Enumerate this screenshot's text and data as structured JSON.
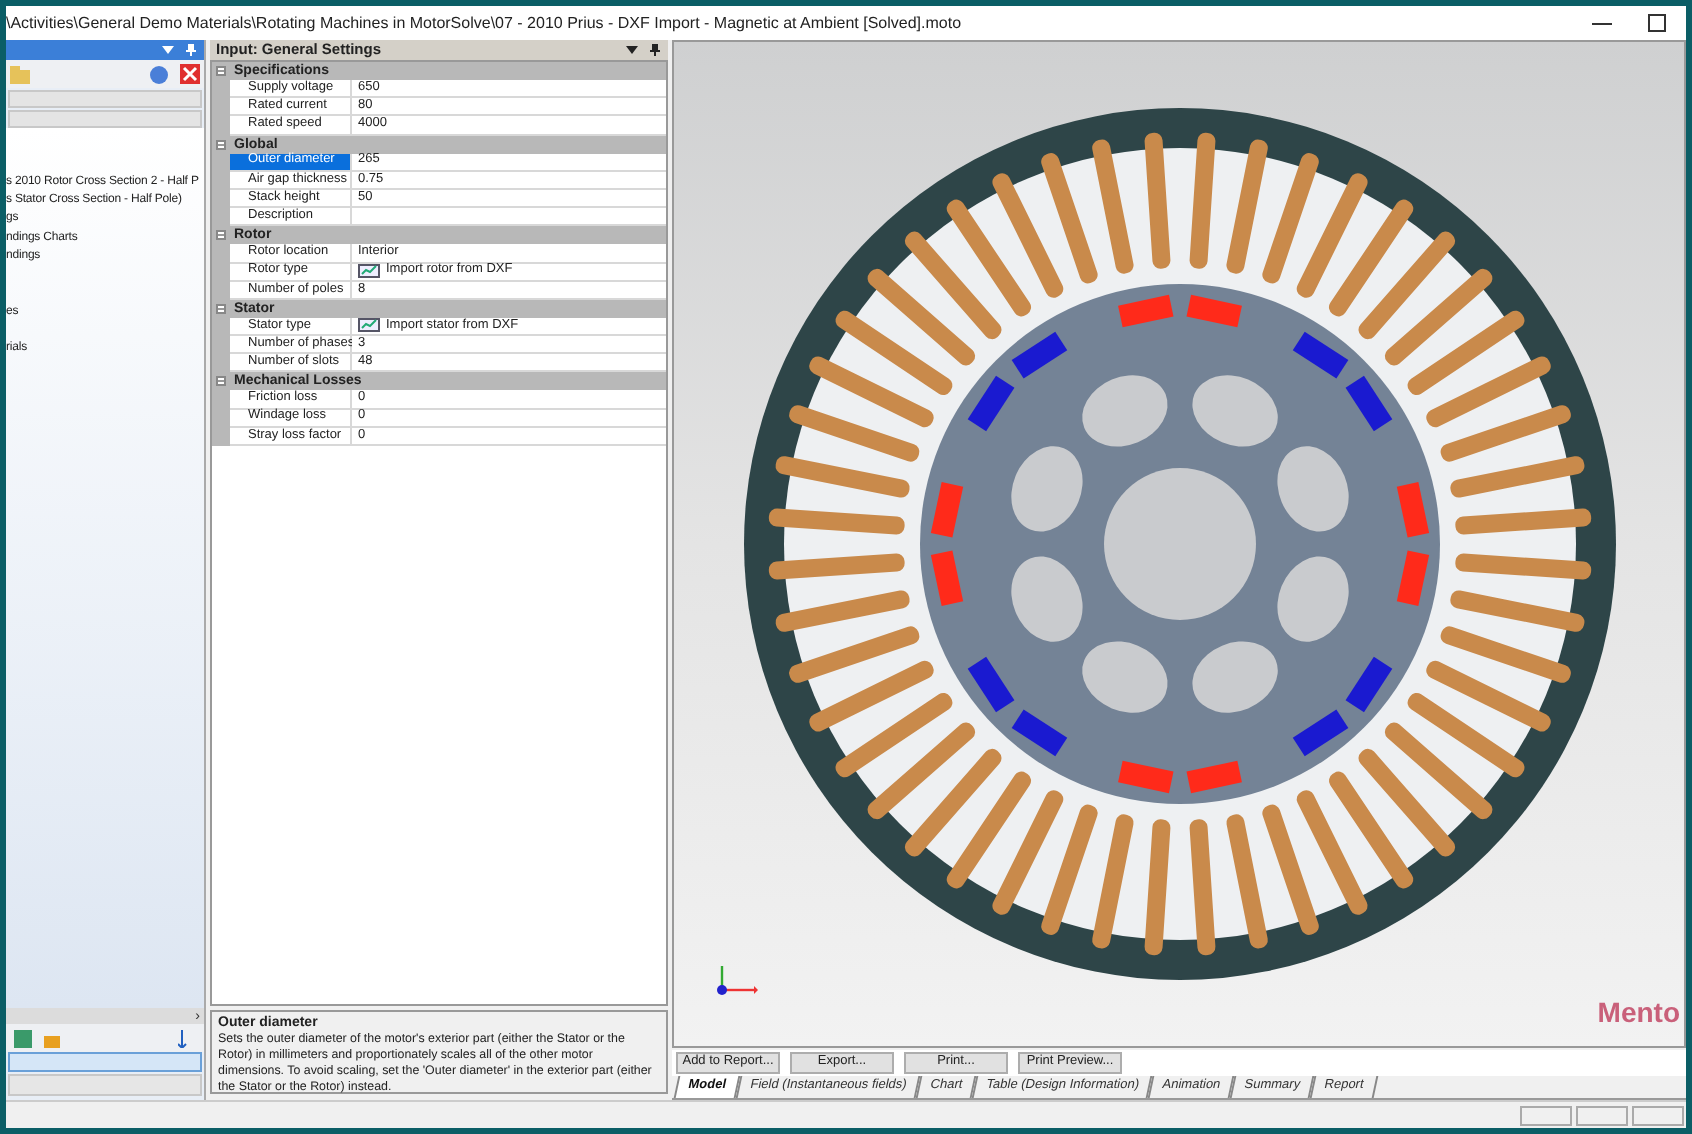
{
  "title_bar": {
    "path": "\\Activities\\General Demo Materials\\Rotating Machines in MotorSolve\\07 - 2010 Prius - DXF Import - Magnetic at Ambient [Solved].moto"
  },
  "left_panel": {
    "tree_items": [
      "s 2010 Rotor Cross Section 2 - Half P",
      "s Stator Cross Section - Half Pole)",
      "gs",
      "ndings Charts",
      "ndings",
      "es",
      "rials"
    ],
    "scroll_arrow": "›"
  },
  "properties": {
    "title": "Input: General Settings",
    "categories": [
      {
        "name": "Specifications",
        "expanded": true,
        "rows": [
          {
            "label": "Supply voltage",
            "value": "650",
            "kind": "text",
            "selected": false
          },
          {
            "label": "Rated current",
            "value": "80",
            "kind": "text",
            "selected": false
          },
          {
            "label": "Rated speed",
            "value": "4000",
            "kind": "text",
            "selected": false
          }
        ]
      },
      {
        "name": "Global",
        "expanded": true,
        "rows": [
          {
            "label": "Outer diameter",
            "value": "265",
            "kind": "text",
            "selected": true
          },
          {
            "label": "Air gap thickness",
            "value": "0.75",
            "kind": "text",
            "selected": false
          },
          {
            "label": "Stack height",
            "value": "50",
            "kind": "text",
            "selected": false
          },
          {
            "label": "Description",
            "value": "",
            "kind": "text",
            "selected": false
          }
        ]
      },
      {
        "name": "Rotor",
        "expanded": true,
        "rows": [
          {
            "label": "Rotor location",
            "value": "Interior",
            "kind": "text",
            "selected": false
          },
          {
            "label": "Rotor type",
            "value": "Import rotor from DXF",
            "kind": "import",
            "selected": false
          },
          {
            "label": "Number of poles",
            "value": "8",
            "kind": "text",
            "selected": false
          }
        ]
      },
      {
        "name": "Stator",
        "expanded": true,
        "rows": [
          {
            "label": "Stator type",
            "value": "Import stator from DXF",
            "kind": "import",
            "selected": false
          },
          {
            "label": "Number of phases",
            "value": "3",
            "kind": "text",
            "selected": false
          },
          {
            "label": "Number of slots",
            "value": "48",
            "kind": "text",
            "selected": false
          }
        ]
      },
      {
        "name": "Mechanical Losses",
        "expanded": true,
        "rows": [
          {
            "label": "Friction loss",
            "value": "0",
            "kind": "text",
            "selected": false
          },
          {
            "label": "Windage loss",
            "value": "0",
            "kind": "text",
            "selected": false
          },
          {
            "label": "Stray loss factor",
            "value": "0",
            "kind": "text",
            "selected": false
          }
        ]
      }
    ]
  },
  "description": {
    "title": "Outer diameter",
    "text": "Sets the outer diameter of the motor's exterior part (either the Stator or the Rotor) in millimeters and proportionately scales all of the other motor dimensions. To avoid scaling, set the 'Outer diameter' in the exterior part (either the Stator or the Rotor) instead."
  },
  "viewer": {
    "logo": "Mento",
    "poles": [
      {
        "color": "#ff2a1a"
      },
      {
        "color": "#1a1ad0"
      },
      {
        "color": "#ff2a1a"
      },
      {
        "color": "#1a1ad0"
      },
      {
        "color": "#ff2a1a"
      },
      {
        "color": "#1a1ad0"
      },
      {
        "color": "#ff2a1a"
      },
      {
        "color": "#1a1ad0"
      }
    ]
  },
  "action_buttons": [
    "Add to Report...",
    "Export...",
    "Print...",
    "Print Preview..."
  ],
  "tabs": [
    {
      "label": "Model",
      "selected": true
    },
    {
      "label": "Field (Instantaneous fields)",
      "selected": false
    },
    {
      "label": "Chart",
      "selected": false
    },
    {
      "label": "Table (Design Information)",
      "selected": false
    },
    {
      "label": "Animation",
      "selected": false
    },
    {
      "label": "Summary",
      "selected": false
    },
    {
      "label": "Report",
      "selected": false
    }
  ]
}
